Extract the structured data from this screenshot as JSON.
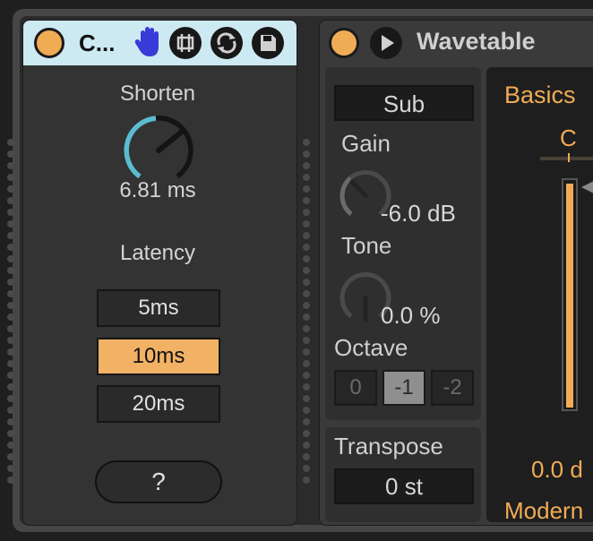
{
  "device1": {
    "title": "C...",
    "shorten": {
      "label": "Shorten",
      "value": "6.81 ms",
      "level": 0.45
    },
    "latency": {
      "label": "Latency",
      "options": [
        "5ms",
        "10ms",
        "20ms"
      ],
      "selected": "10ms"
    },
    "help_label": "?",
    "icons": [
      "hand-icon",
      "map-icon",
      "refresh-icon",
      "save-icon"
    ]
  },
  "device2": {
    "title": "Wavetable",
    "sub": {
      "label": "Sub",
      "gain": {
        "label": "Gain",
        "value": "-6.0 dB"
      },
      "tone": {
        "label": "Tone",
        "value": "0.0 %"
      },
      "octave": {
        "label": "Octave",
        "options": [
          "0",
          "-1",
          "-2"
        ],
        "selected": "-1"
      }
    },
    "transpose": {
      "label": "Transpose",
      "value": "0 st"
    },
    "basics": {
      "label": "Basics",
      "note": "C",
      "value": "0.0 d",
      "mode": "Modern"
    }
  },
  "colors": {
    "accent": "#f0ac55",
    "title_bar": "#cde9f2",
    "knob_arc": "#5bbcd1",
    "hand_icon": "#3a3ad8"
  }
}
